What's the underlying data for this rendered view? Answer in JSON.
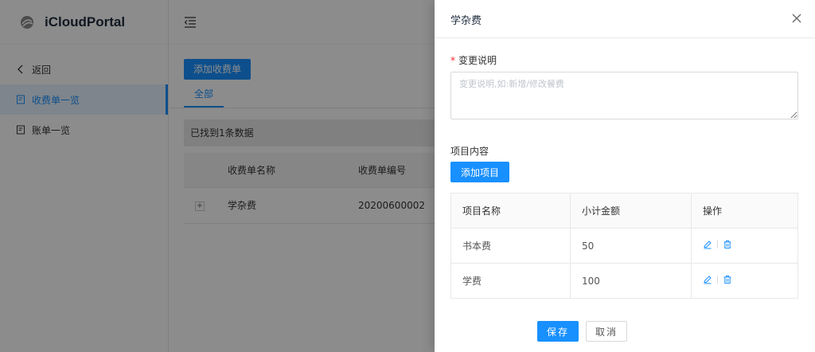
{
  "app": {
    "logo_text": "iCloudPortal"
  },
  "sidebar": {
    "items": [
      {
        "label": "返回",
        "icon": "chevron-left-icon"
      },
      {
        "label": "收费单一览",
        "icon": "document-icon",
        "active": true
      },
      {
        "label": "账单一览",
        "icon": "document-icon"
      }
    ]
  },
  "main": {
    "add_button": "添加收费单",
    "tabs": [
      {
        "label": "全部",
        "active": true
      }
    ],
    "found_text": "已找到1条数据",
    "table": {
      "columns": [
        "收费单名称",
        "收费单编号"
      ],
      "rows": [
        {
          "expand": "+",
          "name": "学杂费",
          "number": "20200600002"
        }
      ]
    }
  },
  "drawer": {
    "title": "学杂费",
    "change_label": "变更说明",
    "change_required_mark": "*",
    "change_placeholder": "变更说明,如:新增/修改餐费",
    "change_value": "",
    "items_label": "项目内容",
    "add_item_button": "添加项目",
    "items_table": {
      "columns": [
        "项目名称",
        "小计金额",
        "操作"
      ],
      "rows": [
        {
          "name": "书本费",
          "amount": "50"
        },
        {
          "name": "学费",
          "amount": "100"
        }
      ]
    },
    "save_button": "保存",
    "cancel_button": "取消"
  },
  "colors": {
    "primary": "#1890ff",
    "overlay": "rgba(0,0,0,0.45)",
    "required": "#f5222d"
  }
}
